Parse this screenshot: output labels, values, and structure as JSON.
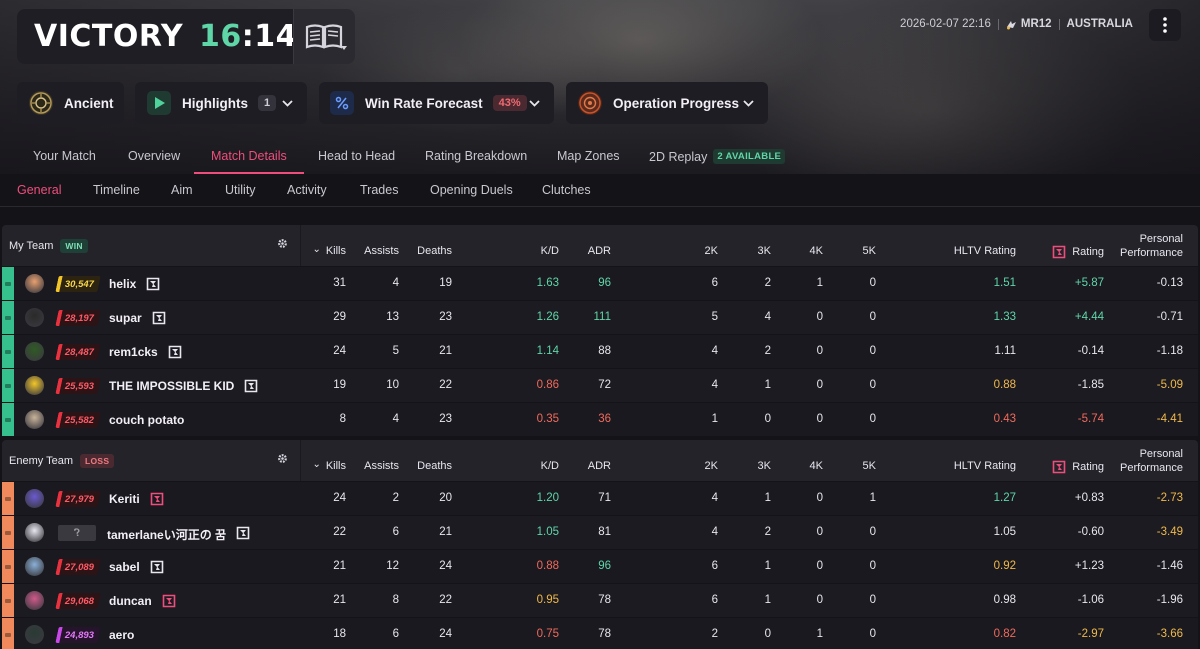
{
  "header": {
    "result": "VICTORY",
    "score_team": "16",
    "score_sep": ":",
    "score_enemy": "14",
    "date": "2026-02-07 22:16",
    "mode": "MR12",
    "region": "AUSTRALIA"
  },
  "pills": {
    "map": "Ancient",
    "highlights": "Highlights",
    "highlights_count": "1",
    "forecast": "Win Rate Forecast",
    "forecast_value": "43%",
    "operation": "Operation Progress"
  },
  "tabs_primary": {
    "your_match": "Your Match",
    "overview": "Overview",
    "match_details": "Match Details",
    "head_to_head": "Head to Head",
    "rating_breakdown": "Rating Breakdown",
    "map_zones": "Map Zones",
    "replay": "2D Replay",
    "replay_badge": "2 AVAILABLE"
  },
  "tabs_secondary": {
    "general": "General",
    "timeline": "Timeline",
    "aim": "Aim",
    "utility": "Utility",
    "activity": "Activity",
    "trades": "Trades",
    "opening_duels": "Opening Duels",
    "clutches": "Clutches"
  },
  "columns": {
    "kills": "Kills",
    "assists": "Assists",
    "deaths": "Deaths",
    "kd": "K/D",
    "adr": "ADR",
    "k2": "2K",
    "k3": "3K",
    "k4": "4K",
    "k5": "5K",
    "hltv": "HLTV Rating",
    "rating": "Rating",
    "personal_1": "Personal",
    "personal_2": "Performance",
    "sort_arrow": "⌄"
  },
  "my_team": {
    "name": "My Team",
    "badge": "WIN",
    "players": [
      {
        "name": "helix",
        "elo": "30,547",
        "tier": "gold",
        "kills": "31",
        "assists": "4",
        "deaths": "19",
        "kd": "1.63",
        "kd_c": "green",
        "adr": "96",
        "adr_c": "green",
        "k2": "6",
        "k3": "2",
        "k4": "1",
        "k5": "0",
        "hltv": "1.51",
        "hltv_c": "green",
        "rating": "+5.87",
        "rating_c": "green",
        "perf": "-0.13",
        "perf_c": "white",
        "logo": "white"
      },
      {
        "name": "supar",
        "elo": "28,197",
        "tier": "red",
        "kills": "29",
        "assists": "13",
        "deaths": "23",
        "kd": "1.26",
        "kd_c": "green",
        "adr": "111",
        "adr_c": "green",
        "k2": "5",
        "k3": "4",
        "k4": "0",
        "k5": "0",
        "hltv": "1.33",
        "hltv_c": "green",
        "rating": "+4.44",
        "rating_c": "green",
        "perf": "-0.71",
        "perf_c": "white",
        "logo": "white"
      },
      {
        "name": "rem1cks",
        "elo": "28,487",
        "tier": "red",
        "kills": "24",
        "assists": "5",
        "deaths": "21",
        "kd": "1.14",
        "kd_c": "green",
        "adr": "88",
        "adr_c": "white",
        "k2": "4",
        "k3": "2",
        "k4": "0",
        "k5": "0",
        "hltv": "1.11",
        "hltv_c": "white",
        "rating": "-0.14",
        "rating_c": "white",
        "perf": "-1.18",
        "perf_c": "white",
        "logo": "white"
      },
      {
        "name": "THE IMPOSSIBLE KID",
        "elo": "25,593",
        "tier": "red",
        "kills": "19",
        "assists": "10",
        "deaths": "22",
        "kd": "0.86",
        "kd_c": "red",
        "adr": "72",
        "adr_c": "white",
        "k2": "4",
        "k3": "1",
        "k4": "0",
        "k5": "0",
        "hltv": "0.88",
        "hltv_c": "yellow",
        "rating": "-1.85",
        "rating_c": "white",
        "perf": "-5.09",
        "perf_c": "yellow",
        "logo": "white"
      },
      {
        "name": "couch potato",
        "elo": "25,582",
        "tier": "red",
        "kills": "8",
        "assists": "4",
        "deaths": "23",
        "kd": "0.35",
        "kd_c": "red",
        "adr": "36",
        "adr_c": "red",
        "k2": "1",
        "k3": "0",
        "k4": "0",
        "k5": "0",
        "hltv": "0.43",
        "hltv_c": "red",
        "rating": "-5.74",
        "rating_c": "red",
        "perf": "-4.41",
        "perf_c": "yellow",
        "logo": "none"
      }
    ]
  },
  "enemy_team": {
    "name": "Enemy Team",
    "badge": "LOSS",
    "players": [
      {
        "name": "Keriti",
        "elo": "27,979",
        "tier": "red",
        "kills": "24",
        "assists": "2",
        "deaths": "20",
        "kd": "1.20",
        "kd_c": "green",
        "adr": "71",
        "adr_c": "white",
        "k2": "4",
        "k3": "1",
        "k4": "0",
        "k5": "1",
        "hltv": "1.27",
        "hltv_c": "green",
        "rating": "+0.83",
        "rating_c": "white",
        "perf": "-2.73",
        "perf_c": "yellow",
        "logo": "pink"
      },
      {
        "name": "tamerlaneい河正の 꿈",
        "elo": "?",
        "tier": "unk",
        "kills": "22",
        "assists": "6",
        "deaths": "21",
        "kd": "1.05",
        "kd_c": "green",
        "adr": "81",
        "adr_c": "white",
        "k2": "4",
        "k3": "2",
        "k4": "0",
        "k5": "0",
        "hltv": "1.05",
        "hltv_c": "white",
        "rating": "-0.60",
        "rating_c": "white",
        "perf": "-3.49",
        "perf_c": "yellow",
        "logo": "white"
      },
      {
        "name": "sabel",
        "elo": "27,089",
        "tier": "red",
        "kills": "21",
        "assists": "12",
        "deaths": "24",
        "kd": "0.88",
        "kd_c": "red",
        "adr": "96",
        "adr_c": "green",
        "k2": "6",
        "k3": "1",
        "k4": "0",
        "k5": "0",
        "hltv": "0.92",
        "hltv_c": "yellow",
        "rating": "+1.23",
        "rating_c": "white",
        "perf": "-1.46",
        "perf_c": "white",
        "logo": "white"
      },
      {
        "name": "duncan",
        "elo": "29,068",
        "tier": "red",
        "kills": "21",
        "assists": "8",
        "deaths": "22",
        "kd": "0.95",
        "kd_c": "yellow",
        "adr": "78",
        "adr_c": "white",
        "k2": "6",
        "k3": "1",
        "k4": "0",
        "k5": "0",
        "hltv": "0.98",
        "hltv_c": "white",
        "rating": "-1.06",
        "rating_c": "white",
        "perf": "-1.96",
        "perf_c": "white",
        "logo": "pink"
      },
      {
        "name": "aero",
        "elo": "24,893",
        "tier": "purple",
        "kills": "18",
        "assists": "6",
        "deaths": "24",
        "kd": "0.75",
        "kd_c": "red",
        "adr": "78",
        "adr_c": "white",
        "k2": "2",
        "k3": "0",
        "k4": "1",
        "k5": "0",
        "hltv": "0.82",
        "hltv_c": "red",
        "rating": "-2.97",
        "rating_c": "yellow",
        "perf": "-3.66",
        "perf_c": "yellow",
        "logo": "none"
      }
    ]
  },
  "colors": {
    "accent": "#ef4e7c",
    "win": "#35c08e",
    "loss": "#f08a5c",
    "positive": "#5fd6a8",
    "negative": "#f06a5c",
    "warning": "#f0b94a"
  },
  "icons": {
    "book": "guide-book-icon",
    "menu": "vertical-dots-icon",
    "play": "play-icon",
    "percent": "percent-icon",
    "gear": "gear-icon",
    "faceit": "faceit-logo-icon",
    "chevron": "chevron-down-icon"
  }
}
